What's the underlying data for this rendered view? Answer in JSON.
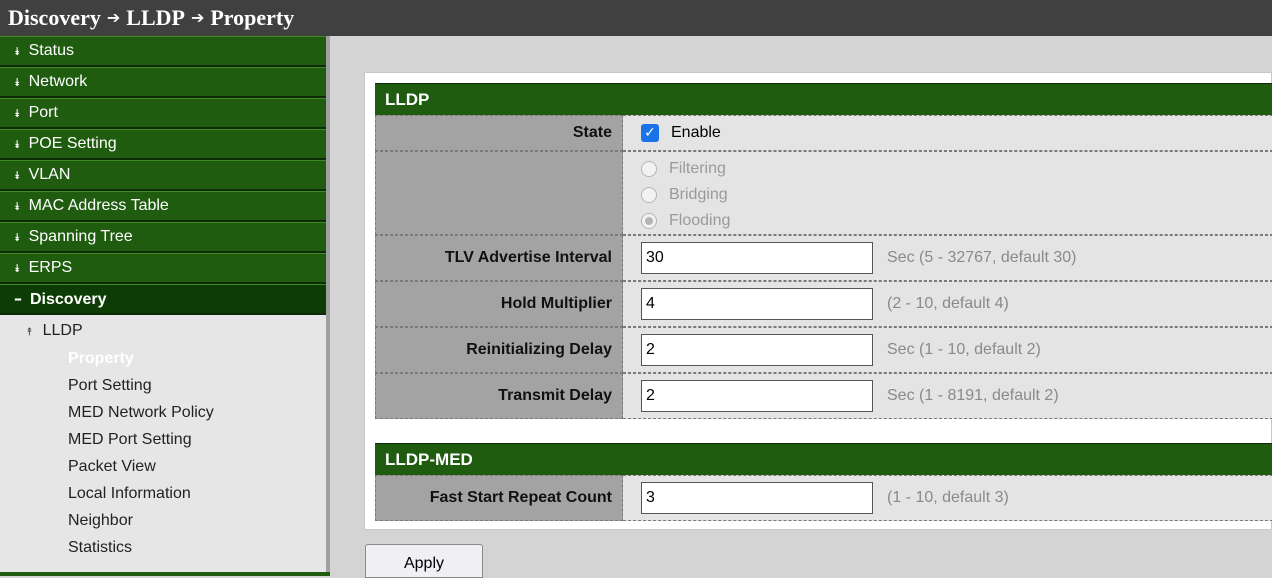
{
  "breadcrumb": {
    "level1": "Discovery",
    "level2": "LLDP",
    "level3": "Property",
    "separator": "➔"
  },
  "sidebar": {
    "items": [
      {
        "label": "Status"
      },
      {
        "label": "Network"
      },
      {
        "label": "Port"
      },
      {
        "label": "POE Setting"
      },
      {
        "label": "VLAN"
      },
      {
        "label": "MAC Address Table"
      },
      {
        "label": "Spanning Tree"
      },
      {
        "label": "ERPS"
      }
    ],
    "open_item": {
      "label": "Discovery",
      "glyph": "–"
    },
    "sub_parent": {
      "label": "LLDP"
    },
    "sub_items": [
      {
        "label": "Property"
      },
      {
        "label": "Port Setting"
      },
      {
        "label": "MED Network Policy"
      },
      {
        "label": "MED Port Setting"
      },
      {
        "label": "Packet View"
      },
      {
        "label": "Local Information"
      },
      {
        "label": "Neighbor"
      },
      {
        "label": "Statistics"
      }
    ],
    "active_sub_item": "Property"
  },
  "lldp": {
    "header": "LLDP",
    "state_label": "State",
    "state_checked": true,
    "state_value": "Enable",
    "frame_options": [
      {
        "label": "Filtering",
        "selected": false
      },
      {
        "label": "Bridging",
        "selected": false
      },
      {
        "label": "Flooding",
        "selected": true
      }
    ],
    "tlv_label": "TLV Advertise Interval",
    "tlv_value": "30",
    "tlv_hint": "Sec (5 - 32767, default 30)",
    "hold_label": "Hold Multiplier",
    "hold_value": "4",
    "hold_hint": "(2 - 10, default 4)",
    "reinit_label": "Reinitializing Delay",
    "reinit_value": "2",
    "reinit_hint": "Sec (1 - 10, default 2)",
    "transmit_label": "Transmit Delay",
    "transmit_value": "2",
    "transmit_hint": "Sec (1 - 8191, default 2)"
  },
  "lldp_med": {
    "header": "LLDP-MED",
    "fast_label": "Fast Start Repeat Count",
    "fast_value": "3",
    "fast_hint": "(1 - 10, default 3)"
  },
  "apply_label": "Apply",
  "colors": {
    "accent_green": "#1f5c0f",
    "label_gray": "#a3a3a3",
    "value_gray": "#e4e4e4",
    "checkbox_blue": "#1a73e8"
  }
}
